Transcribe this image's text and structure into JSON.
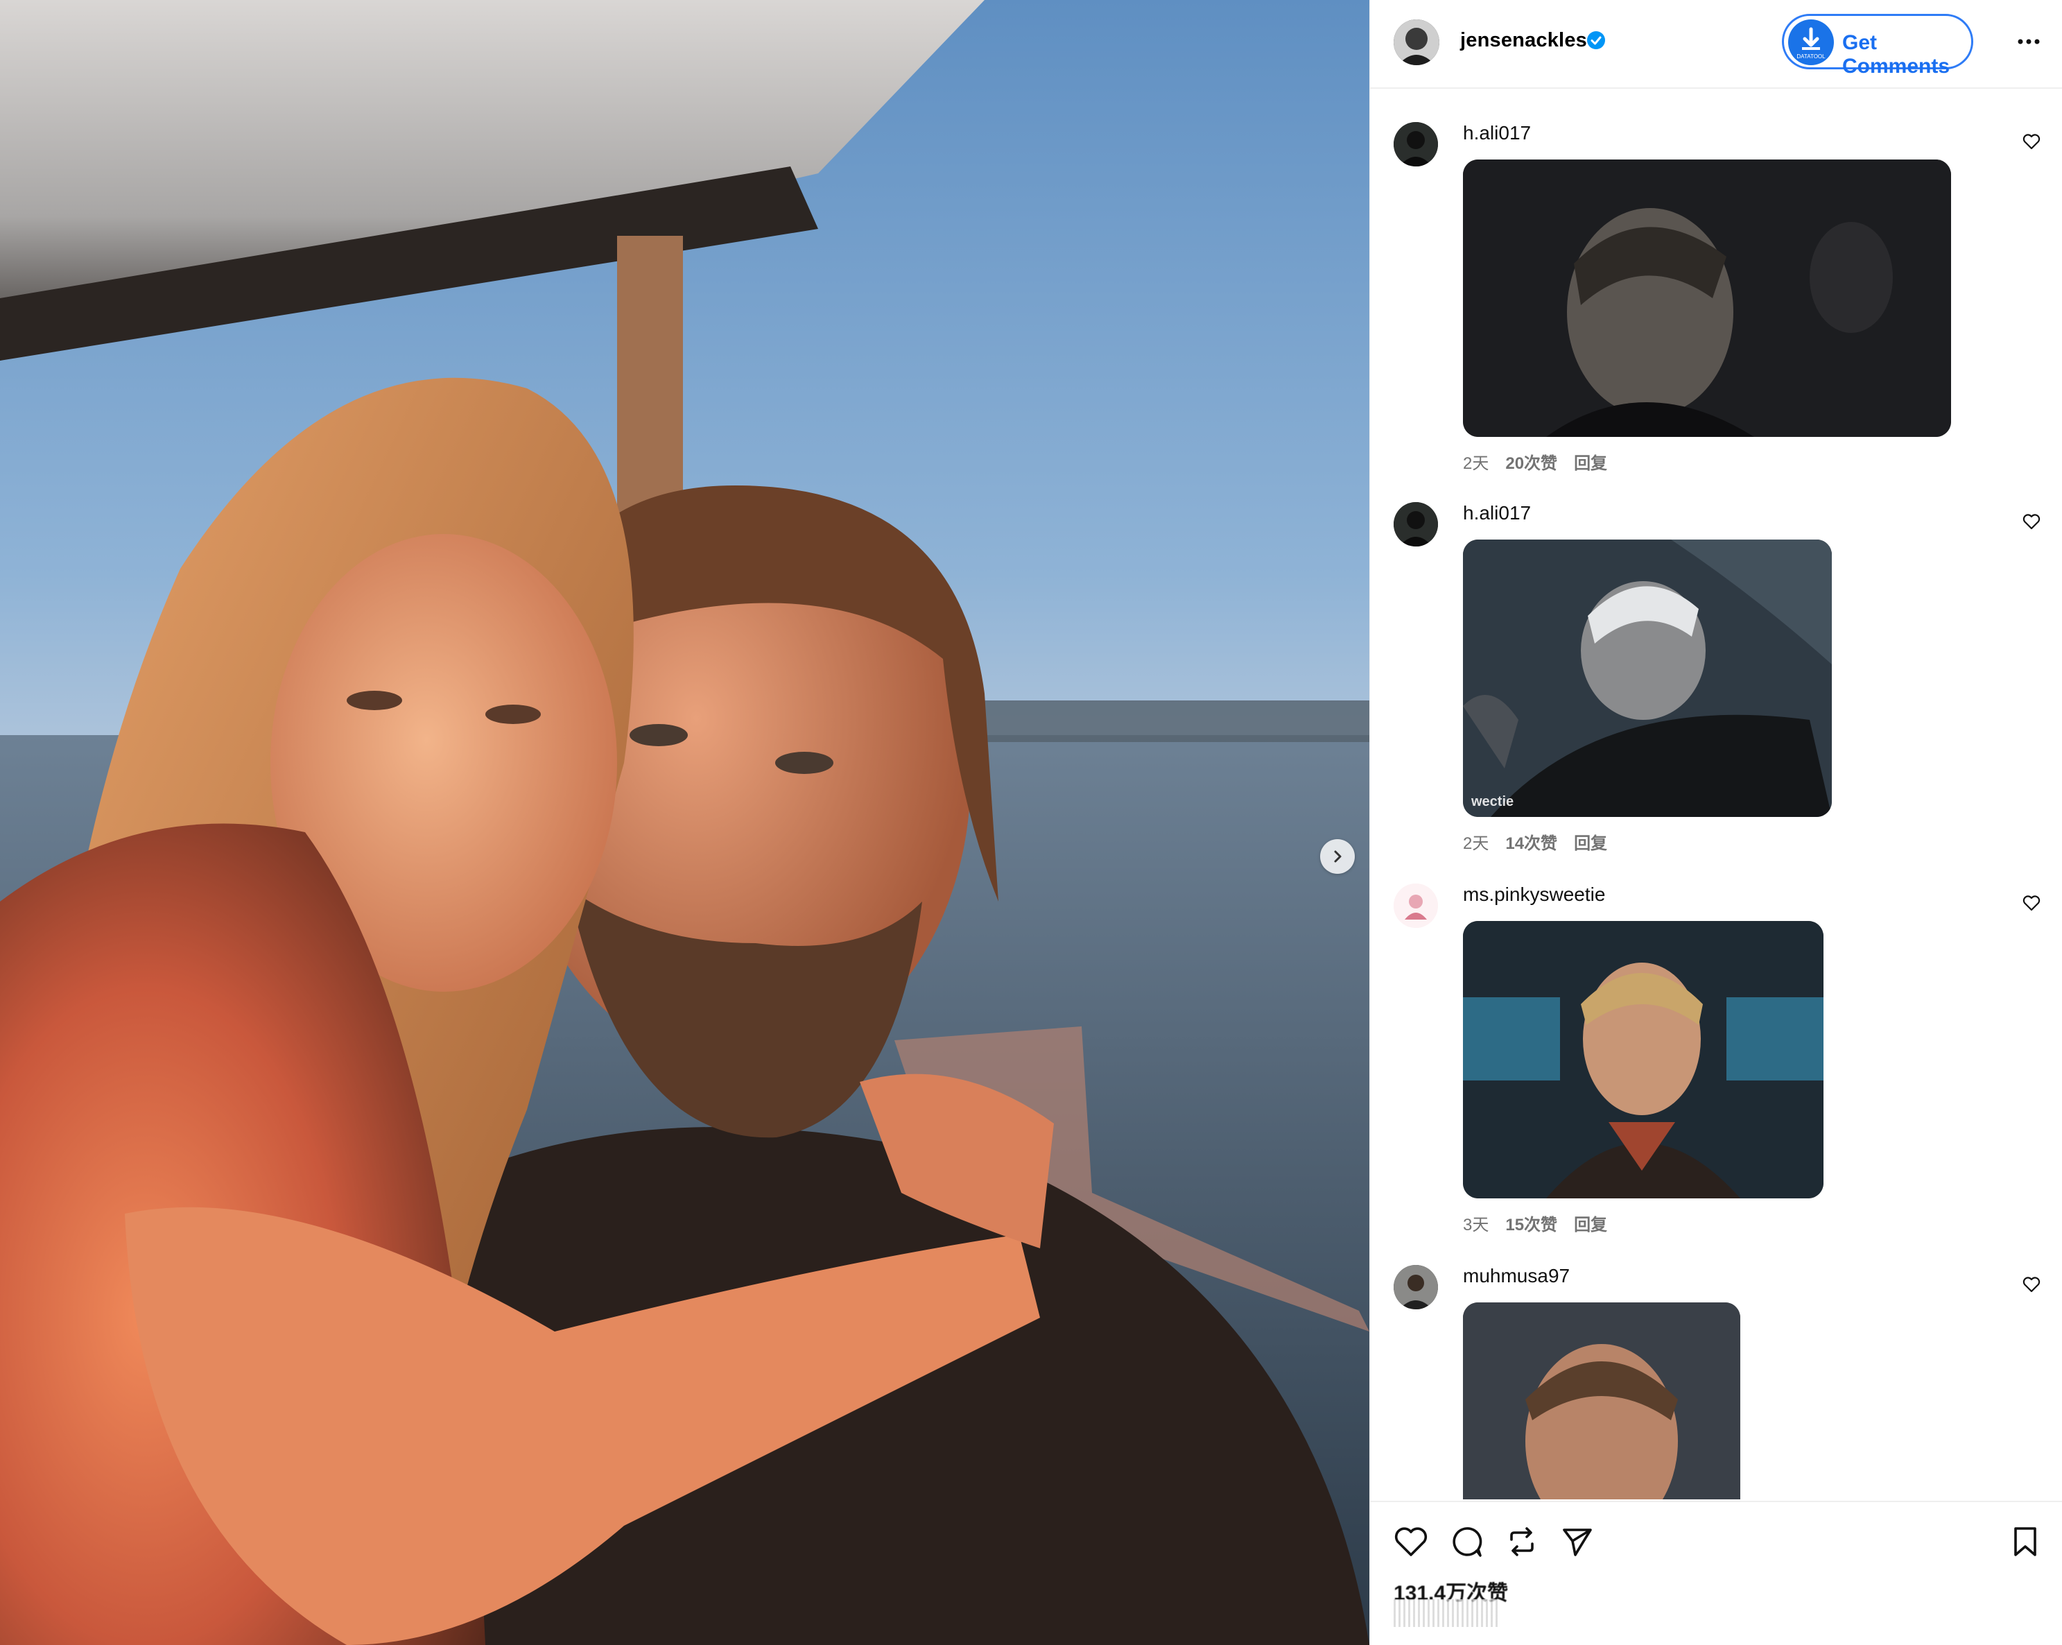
{
  "post": {
    "username": "jensenackles",
    "verified": true,
    "get_comments_label": "Get Comments",
    "get_comments_icon_text": "DATATOOL"
  },
  "comments": [
    {
      "username": "h.ali017",
      "time": "2天",
      "likes": "20次赞",
      "reply": "回复",
      "gif_caption": ""
    },
    {
      "username": "h.ali017",
      "time": "2天",
      "likes": "14次赞",
      "reply": "回复",
      "gif_caption": "wectie"
    },
    {
      "username": "ms.pinkysweetie",
      "time": "3天",
      "likes": "15次赞",
      "reply": "回复",
      "gif_caption": ""
    },
    {
      "username": "muhmusa97",
      "time": "",
      "likes": "",
      "reply": "",
      "gif_caption": ""
    }
  ],
  "footer": {
    "likes_count": "131.4万次赞"
  },
  "icons": {
    "verified": "verified-badge-icon",
    "more": "more-options-icon",
    "heart": "heart-icon",
    "comment": "comment-icon",
    "repost": "repost-icon",
    "share": "share-icon",
    "bookmark": "bookmark-icon",
    "next": "chevron-right-icon"
  },
  "colors": {
    "accent_blue": "#2f7cf6",
    "verified_blue": "#0095f6",
    "meta_gray": "#737373"
  }
}
